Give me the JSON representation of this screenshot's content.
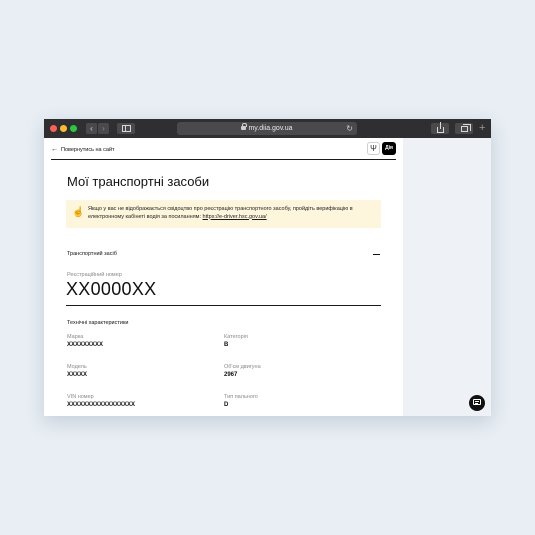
{
  "browser": {
    "url": "my.diia.gov.ua",
    "back_glyph": "‹",
    "forward_glyph": "›",
    "new_tab_glyph": "+",
    "reload_glyph": "↻"
  },
  "header": {
    "back_link": "Повернутись на сайт",
    "trident_glyph": "Ψ",
    "diia_label": "Дія"
  },
  "page": {
    "title": "Мої транспортні засоби"
  },
  "notice": {
    "icon_glyph": "☝",
    "text": "Якщо у вас не відображається свідоцтво про реєстрацію транспортного засобу, пройдіть верифікацію в електронному кабінеті водія за посиланням:",
    "link": "https://e-driver.hsc.gov.ua/"
  },
  "vehicle": {
    "section_label": "Транспортний засіб",
    "reg_label": "Реєстраційний номер",
    "reg_number": "XX0000XX",
    "specs_title": "Технічні характеристики",
    "specs": [
      {
        "label": "Марка",
        "value": "XXXXXXXXX"
      },
      {
        "label": "Категорія",
        "value": "B"
      },
      {
        "label": "Модель",
        "value": "XXXXX"
      },
      {
        "label": "Об'єм двигуна",
        "value": "2967"
      },
      {
        "label": "VIN номер",
        "value": "XXXXXXXXXXXXXXXXX"
      },
      {
        "label": "Тип пального",
        "value": "D"
      }
    ]
  },
  "colors": {
    "titlebar": "#2f2f31",
    "notice_bg": "#fdf5dc",
    "page_bg": "#e8eef4",
    "accent": "#000000"
  }
}
